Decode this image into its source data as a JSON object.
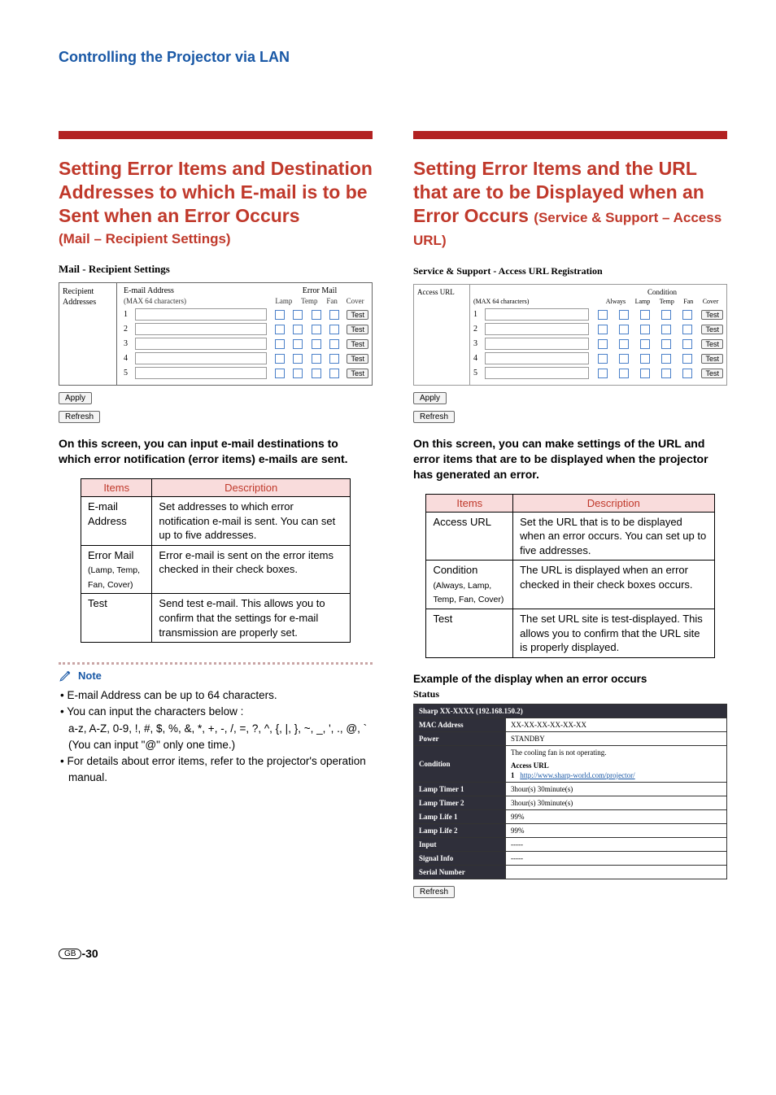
{
  "header": "Controlling the Projector via LAN",
  "left": {
    "title": "Setting Error Items and Destination Addresses to which E-mail is to be Sent when an Error Occurs",
    "subtitle": "(Mail – Recipient Settings)",
    "ss_title": "Mail - Recipient Settings",
    "side_label_l1": "Recipient",
    "side_label_l2": "Addresses",
    "h_email": "E-mail Address",
    "h_error": "Error Mail",
    "sub_email": "(MAX 64 characters)",
    "sub_cols": [
      "Lamp",
      "Temp",
      "Fan",
      "Cover"
    ],
    "rows": [
      "1",
      "2",
      "3",
      "4",
      "5"
    ],
    "test": "Test",
    "apply": "Apply",
    "refresh": "Refresh",
    "body": "On this screen, you can input e-mail destinations to which error notification (error items) e-mails are sent.",
    "table": {
      "h_items": "Items",
      "h_desc": "Description",
      "rows": [
        {
          "item": "E-mail Address",
          "desc": "Set addresses to which error notification e-mail is sent. You can set up to five addresses."
        },
        {
          "item": "Error Mail",
          "sub": "(Lamp, Temp, Fan, Cover)",
          "desc": "Error e-mail is sent on the error items checked in their check boxes."
        },
        {
          "item": "Test",
          "desc": "Send test e-mail. This allows you to confirm that the settings for e-mail transmission are properly set."
        }
      ]
    },
    "note_label": "Note",
    "note_items": [
      "E-mail Address can be up to 64 characters.",
      "You can input the characters below :",
      "a-z, A-Z, 0-9, !, #, $, %, &, *, +, -, /, =, ?, ^, {, |, }, ~, _, ', ., @, `",
      "(You can input \"@\" only one time.)",
      "For details about error items, refer to the projector's operation manual."
    ]
  },
  "right": {
    "title": "Setting Error Items and the URL that are to be Displayed when an Error Occurs",
    "subtitle": "(Service & Support – Access URL)",
    "ss_title": "Service & Support - Access URL Registration",
    "side_label": "Access URL",
    "h_cond": "Condition",
    "sub_url": "(MAX 64 characters)",
    "sub_cols": [
      "Always",
      "Lamp",
      "Temp",
      "Fan",
      "Cover"
    ],
    "rows": [
      "1",
      "2",
      "3",
      "4",
      "5"
    ],
    "test": "Test",
    "apply": "Apply",
    "refresh": "Refresh",
    "body": "On this screen, you can make settings of the URL and error items that are to be displayed when the projector has generated an error.",
    "table": {
      "h_items": "Items",
      "h_desc": "Description",
      "rows": [
        {
          "item": "Access URL",
          "desc": "Set the URL that is to be displayed when an error occurs. You can set up to five addresses."
        },
        {
          "item": "Condition",
          "sub": "(Always, Lamp, Temp, Fan, Cover)",
          "desc": "The URL is displayed when an error checked in their check boxes occurs."
        },
        {
          "item": "Test",
          "desc": "The set URL site is test-displayed. This allows you to confirm that the URL site is properly displayed."
        }
      ]
    },
    "example_header": "Example of the display when an error occurs",
    "status_title": "Status",
    "status_device": "Sharp XX-XXXX (192.168.150.2)",
    "status_rows": [
      {
        "k": "MAC Address",
        "v": "XX-XX-XX-XX-XX-XX"
      },
      {
        "k": "Power",
        "v": "STANDBY"
      }
    ],
    "condition_label": "Condition",
    "condition_line1": "The cooling fan is not operating.",
    "condition_line2": "Access URL",
    "condition_link_num": "1",
    "condition_link": "http://www.sharp-world.com/projector/",
    "status_rows2": [
      {
        "k": "Lamp Timer 1",
        "v": "3hour(s) 30minute(s)"
      },
      {
        "k": "Lamp Timer 2",
        "v": "3hour(s) 30minute(s)"
      },
      {
        "k": "Lamp Life 1",
        "v": "99%"
      },
      {
        "k": "Lamp Life 2",
        "v": "99%"
      },
      {
        "k": "Input",
        "v": "-----"
      },
      {
        "k": "Signal Info",
        "v": "-----"
      },
      {
        "k": "Serial Number",
        "v": ""
      }
    ],
    "refresh2": "Refresh"
  },
  "footer_gb": "GB",
  "footer_page": "-30"
}
